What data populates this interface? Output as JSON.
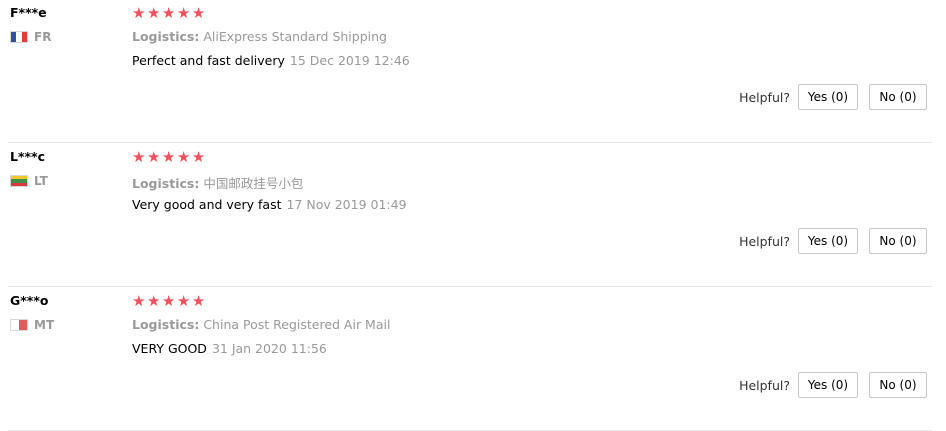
{
  "helpful_label": "Helpful?",
  "reviews": [
    {
      "user": "F***e",
      "country": "FR",
      "flag_colors": [
        "#2f4fa0",
        "#ffffff",
        "#e53b3b"
      ],
      "stars": "★★★★★",
      "logistics_label": "Logistics:",
      "logistics_value": "AliExpress Standard Shipping",
      "feedback": "Perfect and fast delivery",
      "time": "15 Dec 2019 12:46",
      "yes_label": "Yes (0)",
      "no_label": "No (0)"
    },
    {
      "user": "L***c",
      "country": "LT",
      "flag_colors": [
        "#f2c62f",
        "#3f8f4b",
        "#d83b3b"
      ],
      "stars": "★★★★★",
      "logistics_label": "Logistics:",
      "logistics_value": "中国邮政挂号小包",
      "feedback": "Very good and very fast",
      "time": "17 Nov 2019 01:49",
      "yes_label": "Yes (0)",
      "no_label": "No (0)"
    },
    {
      "user": "G***o",
      "country": "MT",
      "flag_colors": [
        "#ffffff",
        "#e25a5a"
      ],
      "stars": "★★★★★",
      "logistics_label": "Logistics:",
      "logistics_value": "China Post Registered Air Mail",
      "feedback": "VERY GOOD",
      "time": "31 Jan 2020 11:56",
      "yes_label": "Yes (0)",
      "no_label": "No (0)"
    }
  ],
  "star_color": "#f2505a",
  "muted_color": "#999999"
}
